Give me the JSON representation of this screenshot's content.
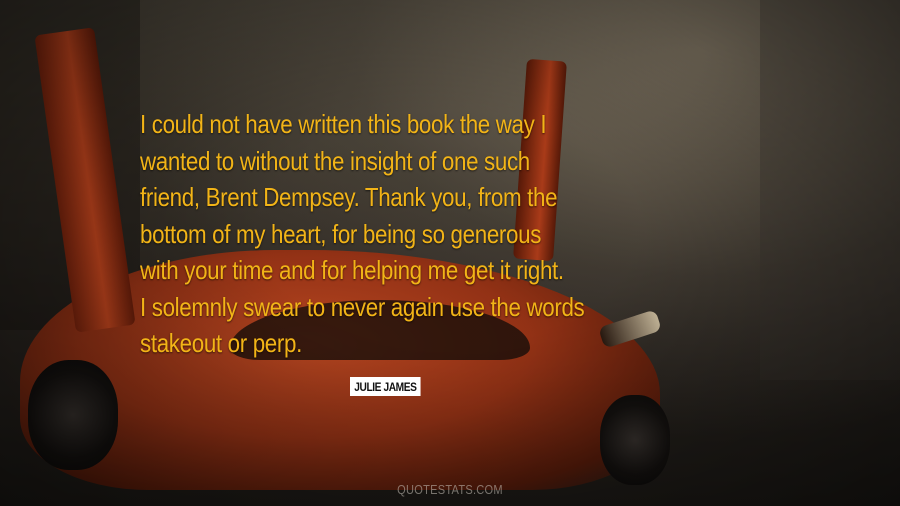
{
  "quote": {
    "lines": [
      "I could not have written this book the way I",
      "wanted to without the insight of one such",
      "friend, Brent Dempsey. Thank you, from the",
      "bottom of my heart, for being so generous",
      "with your time and for helping me get it right.",
      "I solemnly swear to never again use the words",
      "stakeout or perp."
    ],
    "color": "#f2b417"
  },
  "author": "JULIE JAMES",
  "watermark": "QUOTESTATS.COM",
  "background": {
    "subject": "orange sports car with scissor doors on a city street",
    "car_color": "#c24a22"
  }
}
